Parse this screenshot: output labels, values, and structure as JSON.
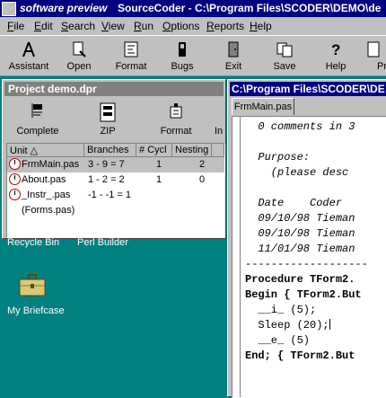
{
  "window": {
    "title_app": "software preview",
    "title_main": "SourceCoder - C:\\Program Files\\SCODER\\DEMO\\de"
  },
  "menu": [
    "File",
    "Edit",
    "Search",
    "View",
    "Run",
    "Options",
    "Reports",
    "Help"
  ],
  "toolbar": [
    {
      "label": "Assistant",
      "icon": "assistant-icon"
    },
    {
      "label": "Open",
      "icon": "open-icon"
    },
    {
      "label": "Format",
      "icon": "format-icon"
    },
    {
      "label": "Bugs",
      "icon": "bugs-icon"
    },
    {
      "label": "Exit",
      "icon": "exit-icon"
    },
    {
      "label": "Save",
      "icon": "save-icon"
    },
    {
      "label": "Help",
      "icon": "help-icon"
    },
    {
      "label": "Pr",
      "icon": "print-icon"
    }
  ],
  "project": {
    "title": "Project demo.dpr",
    "tools": [
      {
        "label": "Complete",
        "icon": "complete-icon"
      },
      {
        "label": "ZIP",
        "icon": "zip-icon"
      },
      {
        "label": "Format",
        "icon": "format-icon"
      },
      {
        "label": "In",
        "icon": "info-icon"
      }
    ],
    "columns": [
      "Unit",
      "Branches",
      "# Cycl",
      "Nesting"
    ],
    "rows": [
      {
        "unit": "FrmMain.pas",
        "branches": "3 - 9 = 7",
        "cycl": "1",
        "nesting": "2",
        "clock": true
      },
      {
        "unit": "About.pas",
        "branches": "1 - 2 = 2",
        "cycl": "1",
        "nesting": "0",
        "clock": true
      },
      {
        "unit": "_Instr_.pas",
        "branches": "-1 - -1 = 1",
        "cycl": "",
        "nesting": "",
        "clock": true
      },
      {
        "unit": "(Forms.pas)",
        "branches": "",
        "cycl": "",
        "nesting": "",
        "clock": false
      }
    ]
  },
  "desktop": {
    "recycle_bin": "Recycle Bin",
    "perl_builder": "Perl Builder",
    "briefcase": "My Briefcase"
  },
  "editor": {
    "title": "C:\\Program Files\\SCODER\\DE",
    "tab": "FrmMain.pas",
    "lines": [
      "  0 comments in 3",
      "",
      "  Purpose:",
      "    (please desc",
      "",
      "  Date    Coder",
      "  09/10/98 Tieman",
      "  09/10/98 Tieman",
      "  11/01/98 Tieman",
      "-------------------",
      "Procedure TForm2.",
      "Begin { TForm2.But",
      "  __i_ (5);",
      "  Sleep (20);",
      "  __e_ (5)",
      "End; { TForm2.But"
    ]
  }
}
